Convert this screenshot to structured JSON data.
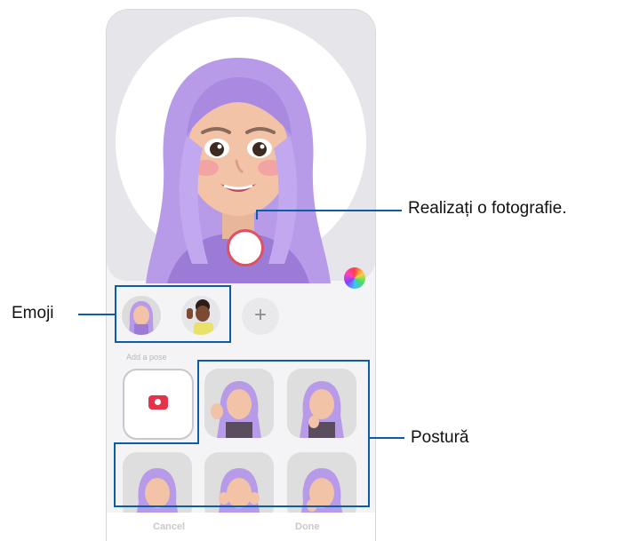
{
  "callouts": {
    "photo": "Realizați o fotografie.",
    "emoji": "Emoji",
    "pose": "Postură"
  },
  "screen": {
    "section_label": "Add a pose",
    "add_emoji": "+",
    "cancel": "Cancel",
    "done": "Done"
  },
  "colors": {
    "callout": "#0a5ea8",
    "hair": "#b89be8",
    "shutter_ring": "#e05060",
    "camera_icon": "#e5334b"
  }
}
